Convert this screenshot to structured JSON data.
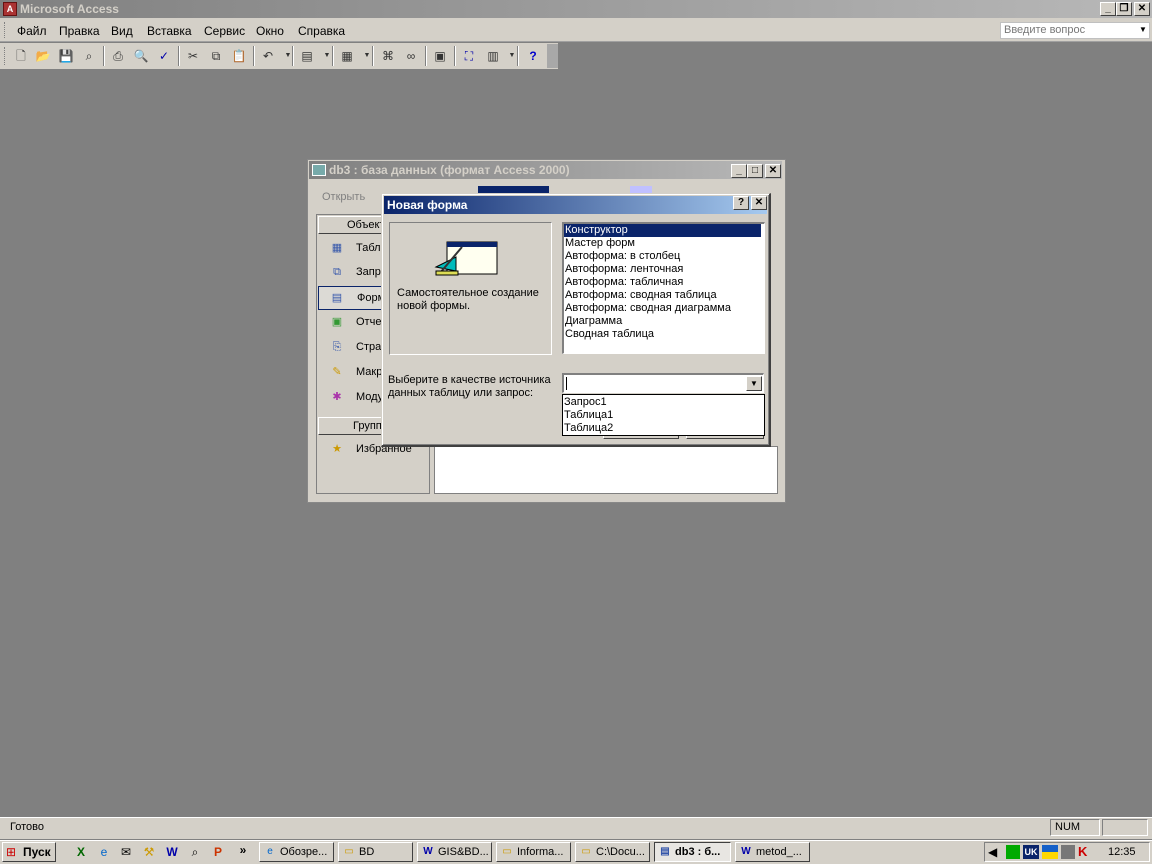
{
  "app": {
    "title": "Microsoft Access",
    "help_placeholder": "Введите вопрос"
  },
  "menu": [
    "Файл",
    "Правка",
    "Вид",
    "Вставка",
    "Сервис",
    "Окно",
    "Справка"
  ],
  "db_window": {
    "title": "db3 : база данных (формат Access 2000)",
    "toolbar_open": "Открыть",
    "objects_header": "Объекты",
    "objects": [
      "Таблицы",
      "Запросы",
      "Формы",
      "Отчеты",
      "Страницы",
      "Макросы",
      "Модули"
    ],
    "groups_header": "Группы",
    "favorites": "Избранное"
  },
  "dialog": {
    "title": "Новая форма",
    "description": "Самостоятельное создание новой формы.",
    "wizard_options": [
      "Конструктор",
      "Мастер форм",
      "Автоформа: в столбец",
      "Автоформа: ленточная",
      "Автоформа: табличная",
      "Автоформа:  сводная таблица",
      "Автоформа:  сводная диаграмма",
      "Диаграмма",
      "Сводная таблица"
    ],
    "selected_index": 0,
    "source_label": "Выберите в качестве источника данных таблицу или запрос:",
    "combo_value": "",
    "source_options": [
      "Запрос1",
      "Таблица1",
      "Таблица2"
    ]
  },
  "status": {
    "text": "Готово",
    "num": "NUM"
  },
  "taskbar": {
    "start": "Пуск",
    "tasks": [
      "Обозре...",
      "BD",
      "GIS&BD...",
      "Informa...",
      "C:\\Docu...",
      "db3 : б...",
      "metod_..."
    ],
    "tray_lang": "UK",
    "clock": "12:35"
  }
}
